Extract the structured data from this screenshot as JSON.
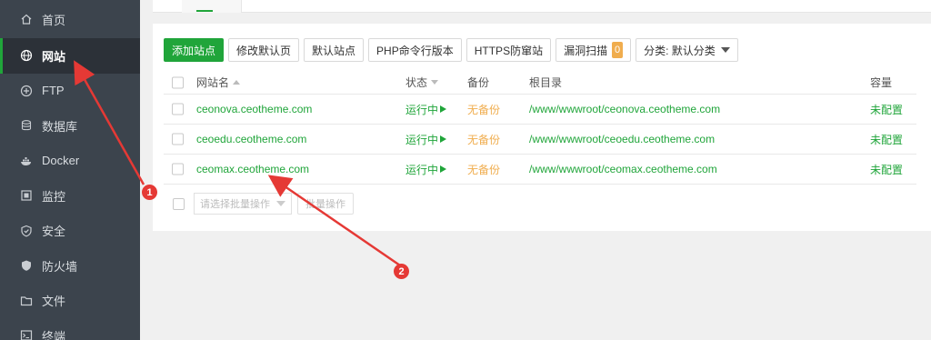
{
  "sidebar": {
    "items": [
      {
        "label": "首页",
        "icon": "home-icon"
      },
      {
        "label": "网站",
        "icon": "globe-icon",
        "active": true
      },
      {
        "label": "FTP",
        "icon": "ftp-icon"
      },
      {
        "label": "数据库",
        "icon": "database-icon"
      },
      {
        "label": "Docker",
        "icon": "docker-icon"
      },
      {
        "label": "监控",
        "icon": "monitor-icon"
      },
      {
        "label": "安全",
        "icon": "shield-icon"
      },
      {
        "label": "防火墙",
        "icon": "firewall-icon"
      },
      {
        "label": "文件",
        "icon": "folder-icon"
      },
      {
        "label": "终端",
        "icon": "terminal-icon"
      }
    ]
  },
  "toolbar": {
    "add_site": "添加站点",
    "edit_default_page": "修改默认页",
    "default_site": "默认站点",
    "php_cli_version": "PHP命令行版本",
    "https_defense": "HTTPS防窜站",
    "vuln_scan": "漏洞扫描",
    "vuln_count": "0",
    "category": "分类: 默认分类"
  },
  "table": {
    "headers": {
      "name": "网站名",
      "status": "状态",
      "backup": "备份",
      "root": "根目录",
      "capacity": "容量"
    },
    "rows": [
      {
        "name": "ceonova.ceotheme.com",
        "status": "运行中",
        "backup": "无备份",
        "root": "/www/wwwroot/ceonova.ceotheme.com",
        "capacity": "未配置"
      },
      {
        "name": "ceoedu.ceotheme.com",
        "status": "运行中",
        "backup": "无备份",
        "root": "/www/wwwroot/ceoedu.ceotheme.com",
        "capacity": "未配置"
      },
      {
        "name": "ceomax.ceotheme.com",
        "status": "运行中",
        "backup": "无备份",
        "root": "/www/wwwroot/ceomax.ceotheme.com",
        "capacity": "未配置"
      }
    ]
  },
  "batch": {
    "select_placeholder": "请选择批量操作",
    "button": "批量操作"
  },
  "annotations": {
    "marker1": "1",
    "marker2": "2",
    "color": "#e53935"
  },
  "colors": {
    "accent": "#20a53a",
    "warning": "#f0ad4e",
    "sidebar_bg": "#3c444d"
  }
}
